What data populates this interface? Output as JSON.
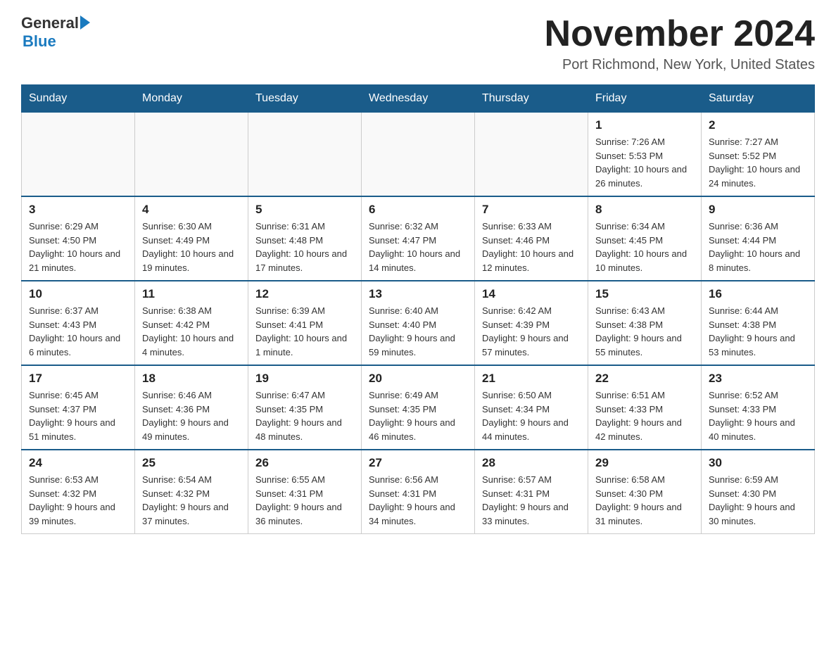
{
  "header": {
    "logo_general": "General",
    "logo_blue": "Blue",
    "month_title": "November 2024",
    "location": "Port Richmond, New York, United States"
  },
  "weekdays": [
    "Sunday",
    "Monday",
    "Tuesday",
    "Wednesday",
    "Thursday",
    "Friday",
    "Saturday"
  ],
  "weeks": [
    [
      {
        "day": "",
        "info": ""
      },
      {
        "day": "",
        "info": ""
      },
      {
        "day": "",
        "info": ""
      },
      {
        "day": "",
        "info": ""
      },
      {
        "day": "",
        "info": ""
      },
      {
        "day": "1",
        "info": "Sunrise: 7:26 AM\nSunset: 5:53 PM\nDaylight: 10 hours and 26 minutes."
      },
      {
        "day": "2",
        "info": "Sunrise: 7:27 AM\nSunset: 5:52 PM\nDaylight: 10 hours and 24 minutes."
      }
    ],
    [
      {
        "day": "3",
        "info": "Sunrise: 6:29 AM\nSunset: 4:50 PM\nDaylight: 10 hours and 21 minutes."
      },
      {
        "day": "4",
        "info": "Sunrise: 6:30 AM\nSunset: 4:49 PM\nDaylight: 10 hours and 19 minutes."
      },
      {
        "day": "5",
        "info": "Sunrise: 6:31 AM\nSunset: 4:48 PM\nDaylight: 10 hours and 17 minutes."
      },
      {
        "day": "6",
        "info": "Sunrise: 6:32 AM\nSunset: 4:47 PM\nDaylight: 10 hours and 14 minutes."
      },
      {
        "day": "7",
        "info": "Sunrise: 6:33 AM\nSunset: 4:46 PM\nDaylight: 10 hours and 12 minutes."
      },
      {
        "day": "8",
        "info": "Sunrise: 6:34 AM\nSunset: 4:45 PM\nDaylight: 10 hours and 10 minutes."
      },
      {
        "day": "9",
        "info": "Sunrise: 6:36 AM\nSunset: 4:44 PM\nDaylight: 10 hours and 8 minutes."
      }
    ],
    [
      {
        "day": "10",
        "info": "Sunrise: 6:37 AM\nSunset: 4:43 PM\nDaylight: 10 hours and 6 minutes."
      },
      {
        "day": "11",
        "info": "Sunrise: 6:38 AM\nSunset: 4:42 PM\nDaylight: 10 hours and 4 minutes."
      },
      {
        "day": "12",
        "info": "Sunrise: 6:39 AM\nSunset: 4:41 PM\nDaylight: 10 hours and 1 minute."
      },
      {
        "day": "13",
        "info": "Sunrise: 6:40 AM\nSunset: 4:40 PM\nDaylight: 9 hours and 59 minutes."
      },
      {
        "day": "14",
        "info": "Sunrise: 6:42 AM\nSunset: 4:39 PM\nDaylight: 9 hours and 57 minutes."
      },
      {
        "day": "15",
        "info": "Sunrise: 6:43 AM\nSunset: 4:38 PM\nDaylight: 9 hours and 55 minutes."
      },
      {
        "day": "16",
        "info": "Sunrise: 6:44 AM\nSunset: 4:38 PM\nDaylight: 9 hours and 53 minutes."
      }
    ],
    [
      {
        "day": "17",
        "info": "Sunrise: 6:45 AM\nSunset: 4:37 PM\nDaylight: 9 hours and 51 minutes."
      },
      {
        "day": "18",
        "info": "Sunrise: 6:46 AM\nSunset: 4:36 PM\nDaylight: 9 hours and 49 minutes."
      },
      {
        "day": "19",
        "info": "Sunrise: 6:47 AM\nSunset: 4:35 PM\nDaylight: 9 hours and 48 minutes."
      },
      {
        "day": "20",
        "info": "Sunrise: 6:49 AM\nSunset: 4:35 PM\nDaylight: 9 hours and 46 minutes."
      },
      {
        "day": "21",
        "info": "Sunrise: 6:50 AM\nSunset: 4:34 PM\nDaylight: 9 hours and 44 minutes."
      },
      {
        "day": "22",
        "info": "Sunrise: 6:51 AM\nSunset: 4:33 PM\nDaylight: 9 hours and 42 minutes."
      },
      {
        "day": "23",
        "info": "Sunrise: 6:52 AM\nSunset: 4:33 PM\nDaylight: 9 hours and 40 minutes."
      }
    ],
    [
      {
        "day": "24",
        "info": "Sunrise: 6:53 AM\nSunset: 4:32 PM\nDaylight: 9 hours and 39 minutes."
      },
      {
        "day": "25",
        "info": "Sunrise: 6:54 AM\nSunset: 4:32 PM\nDaylight: 9 hours and 37 minutes."
      },
      {
        "day": "26",
        "info": "Sunrise: 6:55 AM\nSunset: 4:31 PM\nDaylight: 9 hours and 36 minutes."
      },
      {
        "day": "27",
        "info": "Sunrise: 6:56 AM\nSunset: 4:31 PM\nDaylight: 9 hours and 34 minutes."
      },
      {
        "day": "28",
        "info": "Sunrise: 6:57 AM\nSunset: 4:31 PM\nDaylight: 9 hours and 33 minutes."
      },
      {
        "day": "29",
        "info": "Sunrise: 6:58 AM\nSunset: 4:30 PM\nDaylight: 9 hours and 31 minutes."
      },
      {
        "day": "30",
        "info": "Sunrise: 6:59 AM\nSunset: 4:30 PM\nDaylight: 9 hours and 30 minutes."
      }
    ]
  ]
}
